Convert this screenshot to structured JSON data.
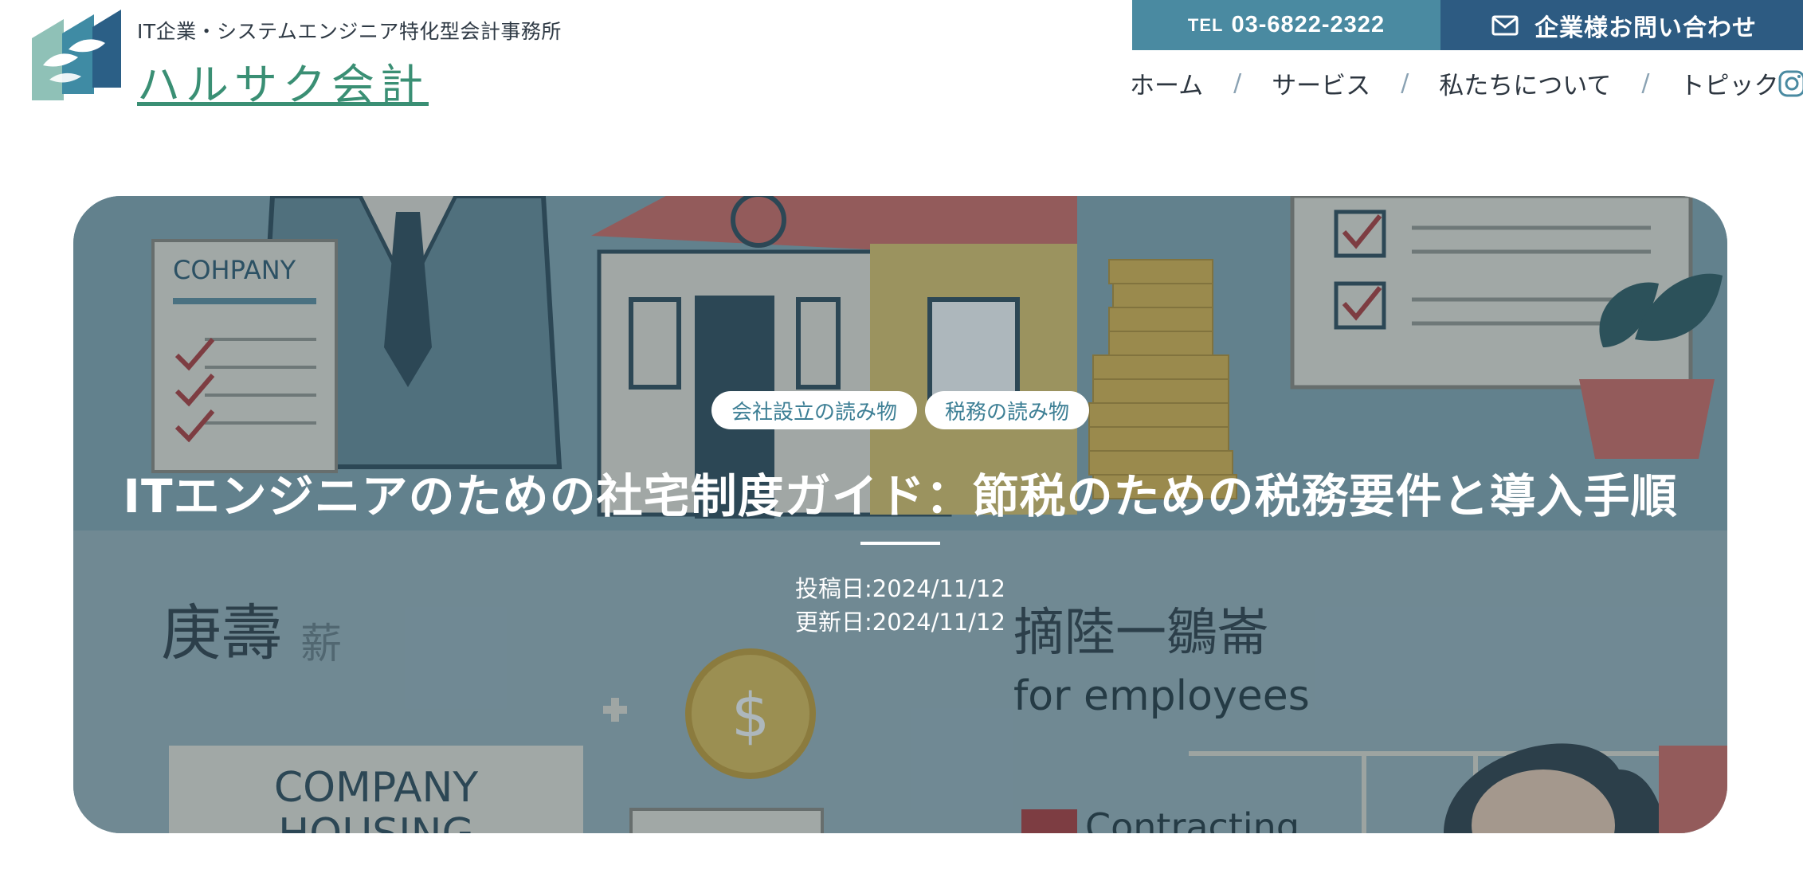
{
  "header": {
    "tagline": "IT企業・システムエンジニア特化型会計事務所",
    "site_title": "ハルサク会計",
    "tel_prefix": "TEL",
    "tel_number": "03-6822-2322",
    "contact_label": "企業様お問い合わせ",
    "nav": [
      {
        "label": "ホーム"
      },
      {
        "label": "サービス"
      },
      {
        "label": "私たちについて"
      },
      {
        "label": "トピック"
      }
    ],
    "nav_separator": "/"
  },
  "hero": {
    "categories": [
      {
        "label": "会社設立の読み物"
      },
      {
        "label": "税務の読み物"
      }
    ],
    "title": "ITエンジニアのための社宅制度ガイド：節税のための税務要件と導入手順",
    "posted": "投稿日:2024/11/12",
    "updated": "更新日:2024/11/12",
    "image_text": {
      "company_sign": "COHPANY",
      "company_housing_1": "COMPANY",
      "company_housing_2": "HOUSING",
      "for_employees": "for employees",
      "contracting": "Contracting",
      "left_kanji": "庚壽",
      "left_kanji_faint": "薪",
      "right_kanji": "摘陸一鶵崙",
      "coin_symbol": "$"
    }
  },
  "colors": {
    "brand_green": "#3a8f74",
    "tel_bg": "#4a8aa1",
    "contact_bg": "#2d5b82",
    "tag_text": "#3d7f95"
  },
  "icons": [
    "logo-mark-icon",
    "mail-icon",
    "instagram-icon"
  ]
}
